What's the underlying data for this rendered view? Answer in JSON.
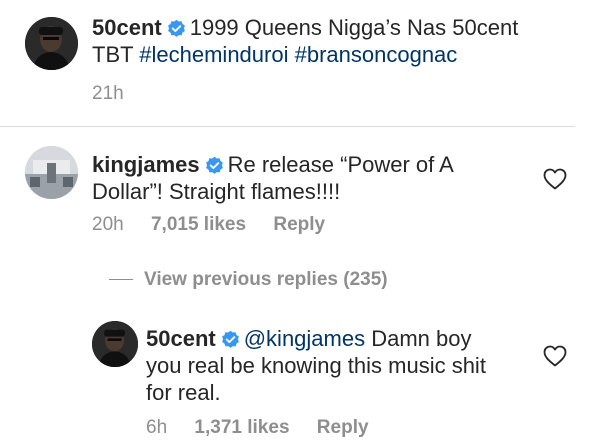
{
  "post": {
    "username": "50cent",
    "caption_text": "1999 Queens Nigga’s Nas 50cent",
    "caption_line2_prefix": "TBT",
    "hashtags": [
      "#lecheminduroi",
      "#bransoncognac"
    ],
    "time": "21h"
  },
  "comment": {
    "username": "kingjames",
    "text_line1": "Re release “Power of A",
    "text_line2": "Dollar”! Straight flames!!!!",
    "time": "20h",
    "likes": "7,015 likes",
    "reply_label": "Reply"
  },
  "view_replies_label": "View previous replies (235)",
  "reply": {
    "username": "50cent",
    "mention": "@kingjames",
    "text_line1": "Damn boy",
    "text_line2": "you real be knowing this music shit",
    "text_line3": "for real.",
    "time": "6h",
    "likes": "1,371 likes",
    "reply_label": "Reply"
  },
  "icons": {
    "verified": "verified-badge-icon",
    "like": "heart-outline-icon"
  },
  "colors": {
    "link": "#003569",
    "verified": "#3897f0",
    "meta": "#8e8e8e",
    "text": "#262626"
  }
}
